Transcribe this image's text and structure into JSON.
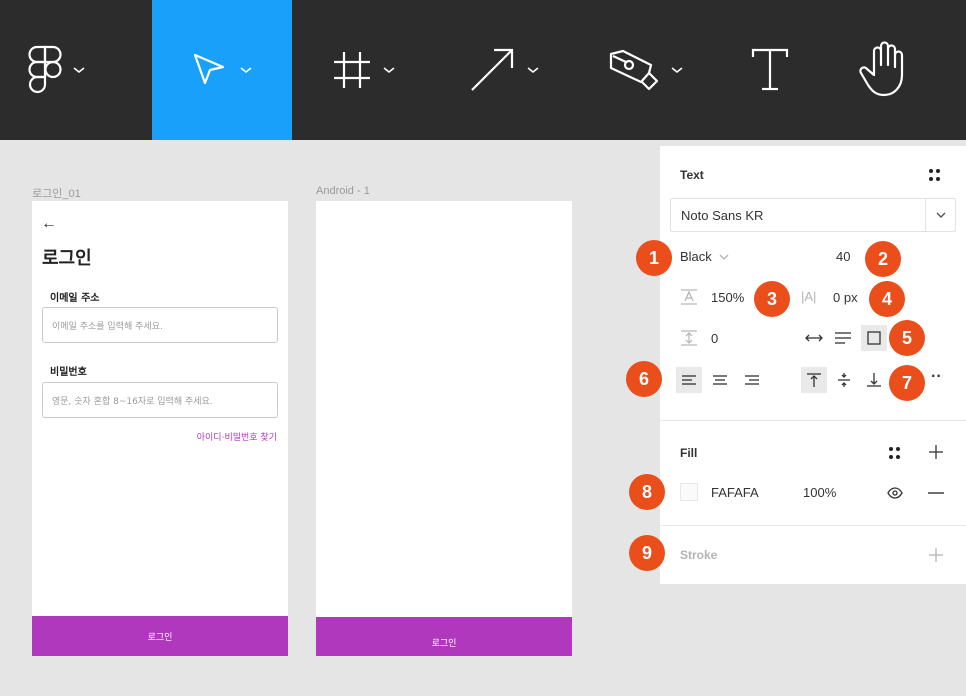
{
  "toolbar": {
    "tools": [
      {
        "name": "figma-menu",
        "icon": "figma-logo-icon",
        "active": false
      },
      {
        "name": "move",
        "icon": "pointer-icon",
        "active": true
      },
      {
        "name": "frame",
        "icon": "frame-hash-icon",
        "active": false
      },
      {
        "name": "shape",
        "icon": "arrow-line-icon",
        "active": false
      },
      {
        "name": "pen",
        "icon": "pen-nib-icon",
        "active": false
      },
      {
        "name": "text",
        "icon": "text-T-icon",
        "active": false
      },
      {
        "name": "hand",
        "icon": "hand-icon",
        "active": false
      }
    ],
    "active_color": "#18a0fb"
  },
  "canvas": {
    "frame1": {
      "label": "로그인_01",
      "back_arrow": "←",
      "title": "로그인",
      "email_label": "이메일 주소",
      "email_placeholder": "이메일 주소를 입력해 주세요.",
      "password_label": "비밀번호",
      "password_placeholder": "영문, 숫자 혼합 8~16자로 입력해 주세요.",
      "find_link": "아이디·비밀번호 찾기",
      "button_label": "로그인"
    },
    "frame2": {
      "label": "Android - 1",
      "button_label": "로그인"
    },
    "accent_color": "#b038bc"
  },
  "panel": {
    "text_section": {
      "title": "Text",
      "font_family": "Noto Sans KR",
      "font_weight": "Black",
      "font_size": "40",
      "line_height": "150%",
      "letter_spacing": "0 px",
      "paragraph_spacing": "0"
    },
    "fill_section": {
      "title": "Fill",
      "hex": "FAFAFA",
      "opacity": "100%"
    },
    "stroke_section": {
      "title": "Stroke"
    }
  },
  "badges": [
    "1",
    "2",
    "3",
    "4",
    "5",
    "6",
    "7",
    "8",
    "9"
  ],
  "badge_color": "#ea4e1b"
}
